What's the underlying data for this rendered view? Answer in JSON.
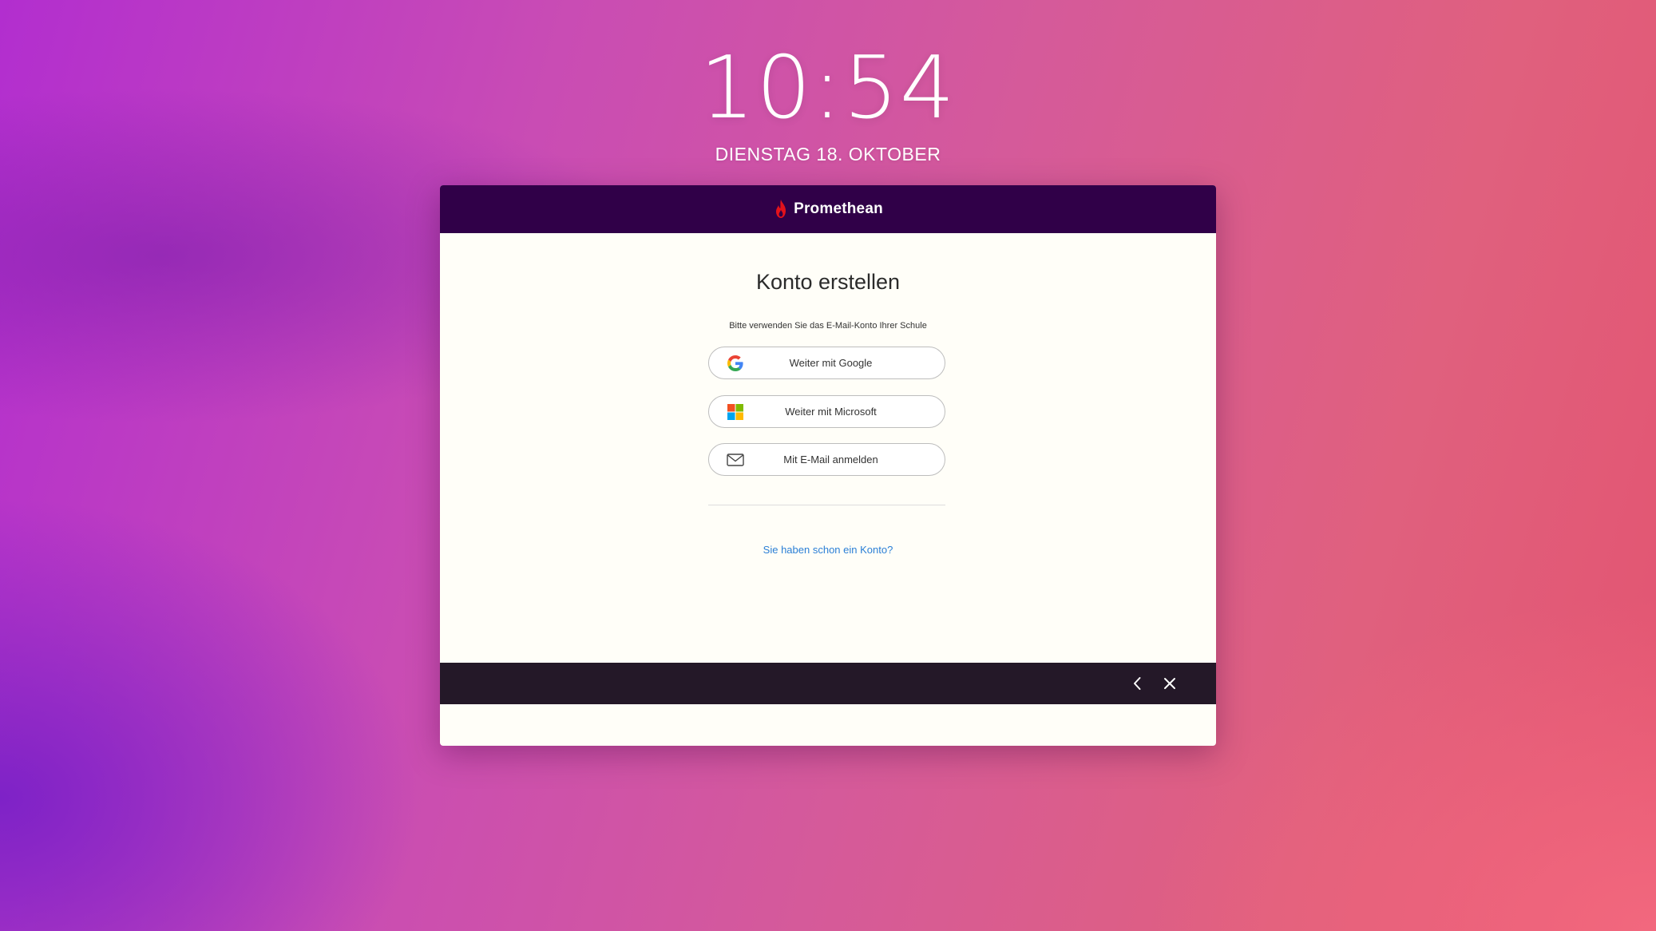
{
  "lock_screen": {
    "time": "10:54",
    "date": "DIENSTAG 18. OKTOBER"
  },
  "dialog": {
    "brand": {
      "name": "Promethean",
      "logo_icon": "flame-icon",
      "logo_color": "#e3121b"
    },
    "header_color": "#300048",
    "title": "Konto erstellen",
    "hint": "Bitte verwenden Sie das E-Mail-Konto Ihrer Schule",
    "buttons": {
      "google": {
        "label": "Weiter mit Google",
        "icon": "google-icon"
      },
      "microsoft": {
        "label": "Weiter mit Microsoft",
        "icon": "microsoft-icon"
      },
      "email": {
        "label": "Mit E-Mail anmelden",
        "icon": "mail-icon"
      }
    },
    "login_link": "Sie haben schon ein Konto?",
    "link_color": "#2b7fd6",
    "footer": {
      "back_icon": "chevron-left-icon",
      "close_icon": "close-icon"
    }
  }
}
